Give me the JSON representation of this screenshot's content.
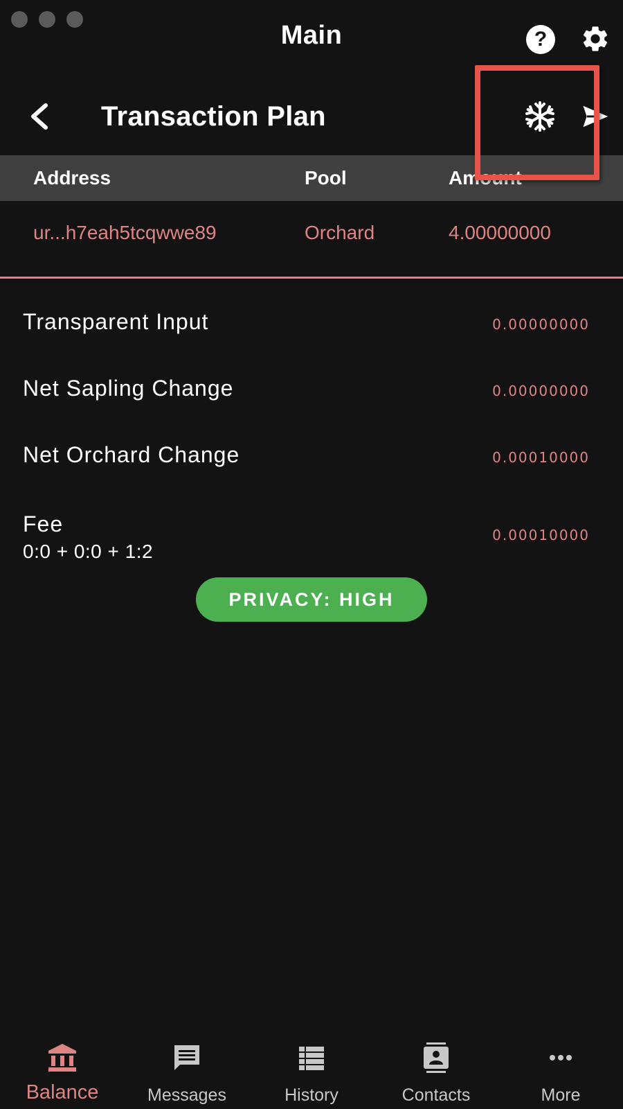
{
  "app": {
    "title": "Main"
  },
  "header": {
    "title": "Transaction Plan"
  },
  "table": {
    "columns": [
      "Address",
      "Pool",
      "Amount"
    ],
    "rows": [
      {
        "address": "ur...h7eah5tcqwwe89",
        "pool": "Orchard",
        "amount": "4.00000000"
      }
    ]
  },
  "summary": {
    "transparent_input": {
      "label": "Transparent Input",
      "value": "0.00000000"
    },
    "net_sapling": {
      "label": "Net Sapling Change",
      "value": "0.00000000"
    },
    "net_orchard": {
      "label": "Net Orchard Change",
      "value": "0.00010000"
    },
    "fee": {
      "label": "Fee",
      "detail": "0:0 + 0:0 + 1:2",
      "value": "0.00010000"
    }
  },
  "privacy": {
    "label": "PRIVACY: HIGH",
    "color": "#4caf50"
  },
  "nav": {
    "items": [
      {
        "label": "Balance",
        "icon": "bank-icon"
      },
      {
        "label": "Messages",
        "icon": "message-icon"
      },
      {
        "label": "History",
        "icon": "list-icon"
      },
      {
        "label": "Contacts",
        "icon": "contact-card-icon"
      },
      {
        "label": "More",
        "icon": "more-dots-icon"
      }
    ],
    "active": "Balance"
  },
  "colors": {
    "accent": "#de8583",
    "background": "#131313",
    "highlight": "#e8544a",
    "table_header": "#404040"
  }
}
